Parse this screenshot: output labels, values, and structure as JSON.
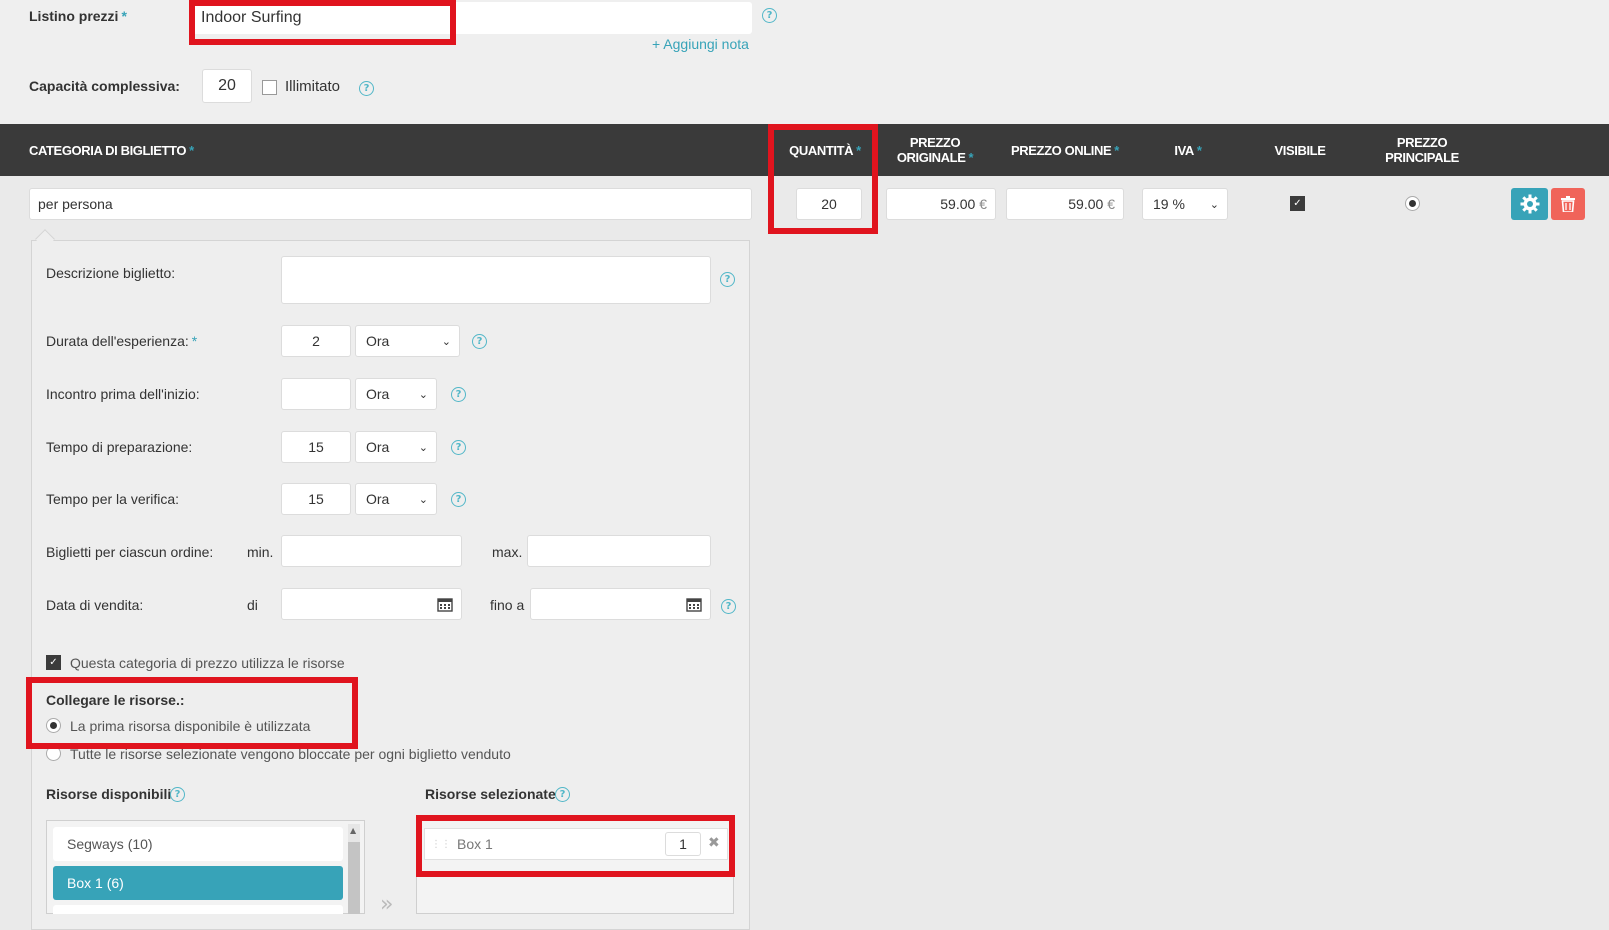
{
  "price_list": {
    "label": "Listino prezzi",
    "value": "Indoor Surfing",
    "add_note": "Aggiungi nota"
  },
  "capacity": {
    "label": "Capacità complessiva:",
    "value": "20",
    "unlimited_label": "Illimitato"
  },
  "table": {
    "headers": {
      "category": "CATEGORIA DI BIGLIETTO",
      "quantity": "QUANTITÀ",
      "original_price_1": "PREZZO",
      "original_price_2": "ORIGINALE",
      "online_price": "PREZZO ONLINE",
      "vat": "IVA",
      "visible": "VISIBILE",
      "main_price_1": "PREZZO",
      "main_price_2": "PRINCIPALE"
    },
    "row": {
      "category": "per persona",
      "quantity": "20",
      "original_price": "59.00",
      "online_price": "59.00",
      "currency": "€",
      "vat": "19 %"
    }
  },
  "details": {
    "description_label": "Descrizione biglietto:",
    "duration_label": "Durata dell'esperienza:",
    "duration_value": "2",
    "duration_unit": "Ora",
    "meeting_label": "Incontro prima dell'inizio:",
    "meeting_value": "",
    "meeting_unit": "Ora",
    "prep_label": "Tempo di preparazione:",
    "prep_value": "15",
    "prep_unit": "Ora",
    "check_label": "Tempo per la verifica:",
    "check_value": "15",
    "check_unit": "Ora",
    "tickets_label": "Biglietti per ciascun ordine:",
    "min_label": "min.",
    "max_label": "max.",
    "sale_date_label": "Data di vendita:",
    "from_label": "di",
    "to_label": "fino a",
    "uses_resources_label": "Questa categoria di prezzo utilizza le risorse",
    "link_resources_label": "Collegare le risorse.:",
    "option_first": "La prima risorsa disponibile è utilizzata",
    "option_all": "Tutte le risorse selezionate vengono bloccate per ogni biglietto venduto",
    "available_label": "Risorse disponibili",
    "selected_label": "Risorse selezionate",
    "available_items": [
      "Segways (10)",
      "Box 1 (6)"
    ],
    "selected_item": "Box 1",
    "selected_qty": "1"
  },
  "colors": {
    "accent": "#37a3b8",
    "danger": "#f0645a",
    "highlight": "#e0141e",
    "header_bg": "#3a3a3a"
  }
}
